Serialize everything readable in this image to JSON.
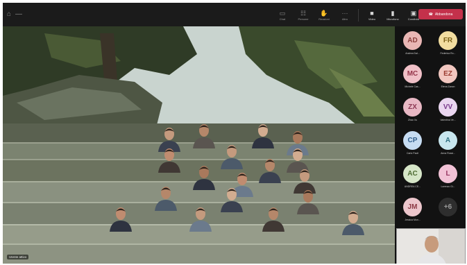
{
  "toolbar": {
    "buttons": [
      {
        "label": "Chat",
        "icon": "chat-icon",
        "glyph": "▭"
      },
      {
        "label": "Persone",
        "icon": "people-icon",
        "glyph": "☷"
      },
      {
        "label": "Reazioni",
        "icon": "reactions-icon",
        "glyph": "✋"
      },
      {
        "label": "Altro",
        "icon": "more-icon",
        "glyph": "···"
      }
    ],
    "media": [
      {
        "label": "Video",
        "icon": "camera-icon",
        "glyph": "■"
      },
      {
        "label": "Microfono",
        "icon": "mic-icon",
        "glyph": "▮"
      },
      {
        "label": "Condividi",
        "icon": "share-icon",
        "glyph": "▣"
      }
    ],
    "leave_label": "Abbandona",
    "leave_color": "#c4314b"
  },
  "stage": {
    "speaker_name": "Utente attivo"
  },
  "participants": [
    {
      "initials": "AD",
      "name": "Andrea Dal...",
      "color": "#e9b6b4",
      "text": "#8a3d3b"
    },
    {
      "initials": "FR",
      "name": "Federica Ro...",
      "color": "#f2dda0",
      "text": "#7d6219"
    },
    {
      "initials": "MC",
      "name": "Michele Cas...",
      "color": "#f0c0c7",
      "text": "#94354a"
    },
    {
      "initials": "EZ",
      "name": "Elena Zanon",
      "color": "#f2c7c0",
      "text": "#9a3b30"
    },
    {
      "initials": "ZX",
      "name": "Zhao Xu",
      "color": "#e8b8c4",
      "text": "#8d3954"
    },
    {
      "initials": "VV",
      "name": "Valentina Ve...",
      "color": "#ead6f0",
      "text": "#7a3b8c"
    },
    {
      "initials": "CP",
      "name": "Carlo Paoli",
      "color": "#c6dcf2",
      "text": "#2f5d8a"
    },
    {
      "initials": "A",
      "name": "Anna Rossi...",
      "color": "#c8e6ee",
      "text": "#2f6f80"
    },
    {
      "initials": "AC",
      "name": "ANDREA CE...",
      "color": "#d6e6c8",
      "text": "#4d6b32"
    },
    {
      "initials": "L",
      "name": "Lorenzo Gi...",
      "color": "#f2c2d6",
      "text": "#963560"
    },
    {
      "initials": "JM",
      "name": "Jessica Mon...",
      "color": "#ecc6cc",
      "text": "#8c3944"
    },
    {
      "initials": "+6",
      "name": "",
      "color": "#2e2e2e",
      "text": "#9a9a9a"
    }
  ]
}
